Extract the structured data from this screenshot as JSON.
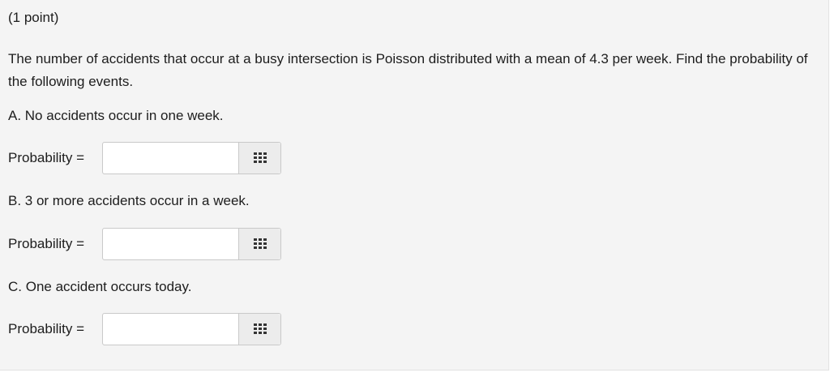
{
  "header": {
    "points": "(1 point)"
  },
  "problem": {
    "text": "The number of accidents that occur at a busy intersection is Poisson distributed with a mean of 4.3 per week. Find the probability of the following events."
  },
  "parts": [
    {
      "prompt": "A. No accidents occur in one week.",
      "answer_label": "Probability =",
      "answer_value": "",
      "icon": "grid-icon"
    },
    {
      "prompt": "B. 3 or more accidents occur in a week.",
      "answer_label": "Probability =",
      "answer_value": "",
      "icon": "grid-icon"
    },
    {
      "prompt": "C. One accident occurs today.",
      "answer_label": "Probability =",
      "answer_value": "",
      "icon": "grid-icon"
    }
  ],
  "colors": {
    "panel_background": "#f4f4f4",
    "icon_color": "#333333"
  }
}
